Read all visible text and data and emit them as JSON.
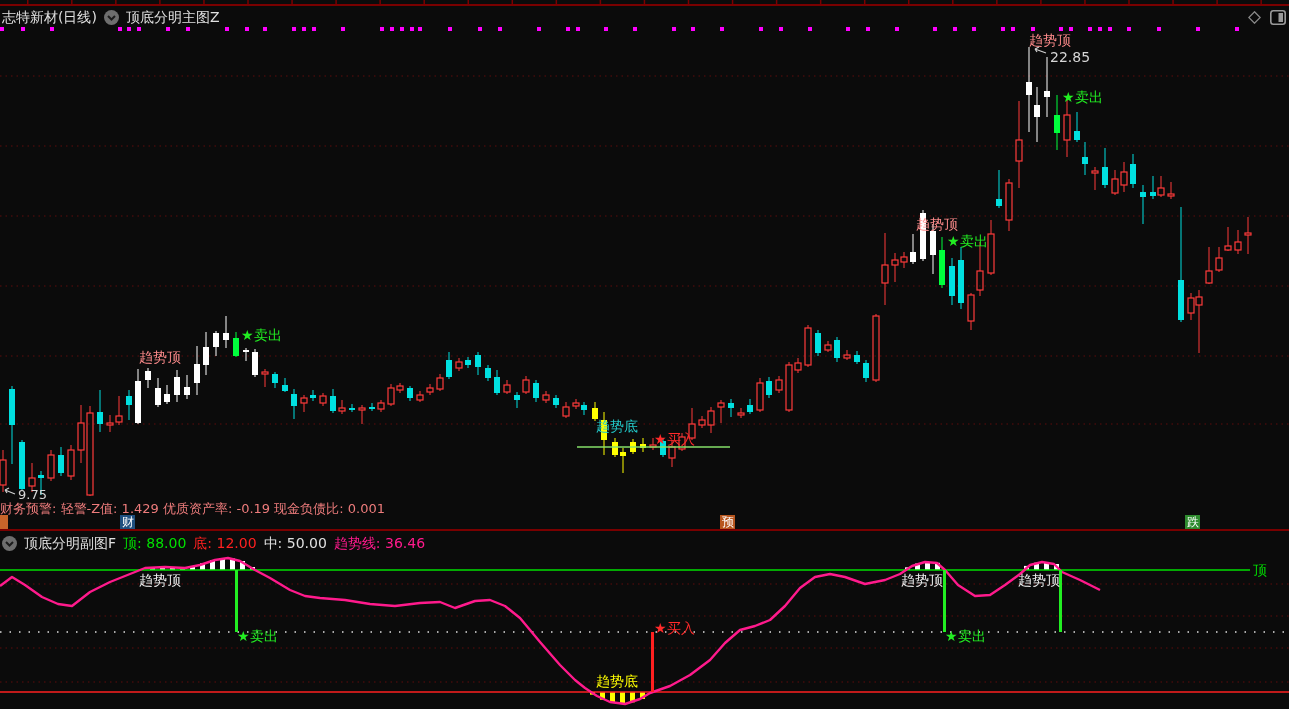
{
  "header": {
    "title": "志特新材(日线)",
    "indicator": "顶底分明主图Z"
  },
  "main_chart": {
    "signals": [
      {
        "kind": "top",
        "text": "趋势顶"
      },
      {
        "kind": "sell",
        "text": "★卖出"
      },
      {
        "kind": "bottom",
        "text": "趋势底"
      },
      {
        "kind": "buy",
        "text": "★买入"
      },
      {
        "kind": "top",
        "text": "趋势顶"
      },
      {
        "kind": "sell",
        "text": "★卖出"
      },
      {
        "kind": "top",
        "text": "趋势顶"
      },
      {
        "kind": "sell",
        "text": "★卖出"
      }
    ],
    "price_marks": [
      {
        "kind": "high",
        "text": "22.85"
      },
      {
        "kind": "low",
        "text": "9.75"
      }
    ],
    "info": "财务预警: 轻警-Z值: 1.429 优质资产率: -0.19 现金负债比: 0.001",
    "event_badges": [
      {
        "color": "#c8642a"
      },
      {
        "text": "财",
        "color": "#1f4f7f"
      },
      {
        "text": "预",
        "color": "#b8561e"
      },
      {
        "text": "跌",
        "color": "#2e8b2e"
      }
    ]
  },
  "sub_chart": {
    "name": "顶底分明副图F",
    "legend": [
      {
        "text": "顶: 88.00",
        "color": "#00e000"
      },
      {
        "text": "底: 12.00",
        "color": "#ff2020"
      },
      {
        "text": "中: 50.00",
        "color": "#e0e0e0"
      },
      {
        "text": "趋势线: 36.46",
        "color": "#ff1a8c"
      }
    ],
    "signals": [
      {
        "kind": "top",
        "text": "趋势顶"
      },
      {
        "kind": "sell",
        "text": "★卖出"
      },
      {
        "kind": "bottom",
        "text": "趋势底"
      },
      {
        "kind": "buy",
        "text": "★买入"
      },
      {
        "kind": "top",
        "text": "趋势顶"
      },
      {
        "kind": "sell",
        "text": "★卖出"
      },
      {
        "kind": "top",
        "text": "趋势顶"
      },
      {
        "kind": "sell"
      }
    ],
    "top_line_label": "顶"
  }
}
